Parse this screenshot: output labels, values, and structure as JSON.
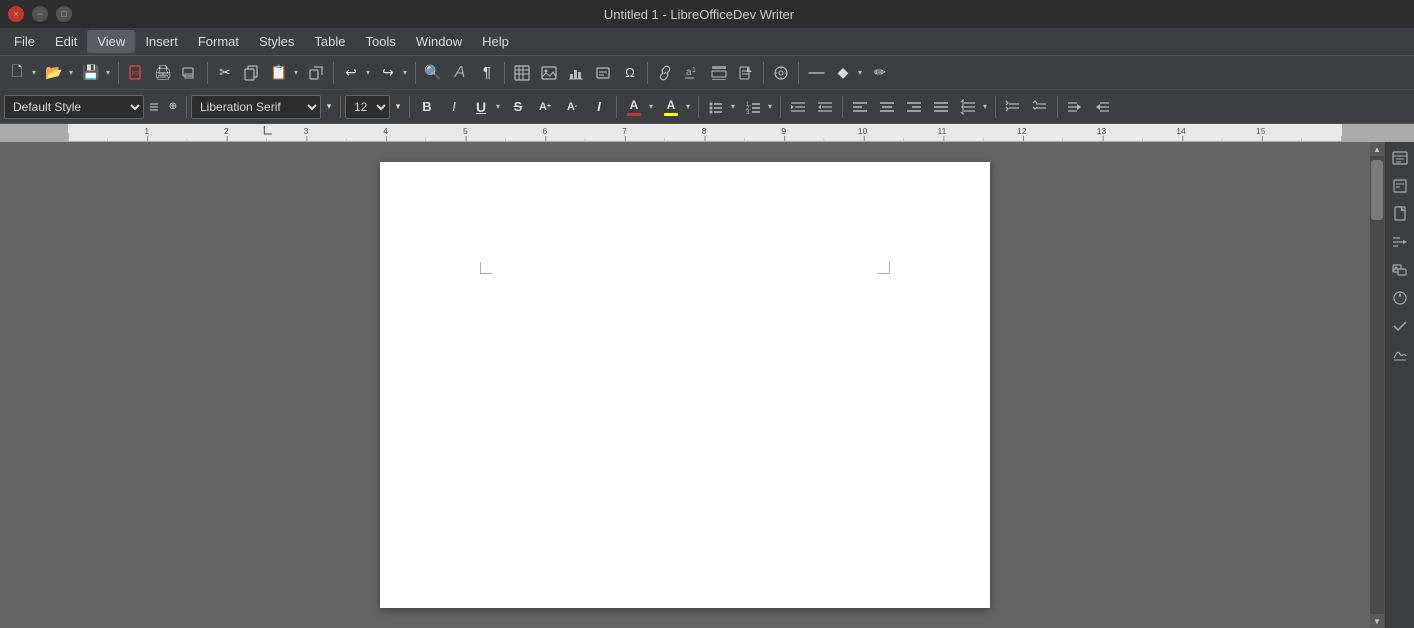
{
  "titlebar": {
    "title": "Untitled 1 - LibreOfficeDev Writer",
    "close_label": "×",
    "minimize_label": "−",
    "maximize_label": "□"
  },
  "menubar": {
    "items": [
      {
        "label": "File"
      },
      {
        "label": "Edit"
      },
      {
        "label": "View"
      },
      {
        "label": "Insert"
      },
      {
        "label": "Format"
      },
      {
        "label": "Styles"
      },
      {
        "label": "Table"
      },
      {
        "label": "Tools"
      },
      {
        "label": "Window"
      },
      {
        "label": "Help"
      }
    ]
  },
  "toolbar1": {
    "new_label": "🗋",
    "open_label": "📂",
    "save_label": "💾",
    "export_pdf_label": "📄",
    "print_label": "🖨",
    "print_preview_label": "🔍",
    "cut_label": "✂",
    "copy_label": "⧉",
    "paste_label": "📋",
    "clone_label": "⊡",
    "undo_label": "↩",
    "redo_label": "↪",
    "find_label": "🔍",
    "styles_label": "A",
    "formatting_marks_label": "¶",
    "table_label": "⊞",
    "image_label": "🖼",
    "chart_label": "📊",
    "text_frame_label": "⬜",
    "special_char_label": "Ω",
    "hyperlink_label": "🔗",
    "footnote_label": "†",
    "header_footer_label": "⬒",
    "page_break_label": "⊡",
    "navigator_label": "◎",
    "line_label": "—",
    "shapes_label": "◆",
    "cursor_label": "✏"
  },
  "toolbar2": {
    "paragraph_style": "Default Style",
    "font_name": "Liberation Serif",
    "font_size": "12",
    "bold_label": "B",
    "italic_label": "I",
    "underline_label": "U",
    "strikethrough_label": "S",
    "superscript_label": "A",
    "subscript_label": "A",
    "shadow_label": "I",
    "font_color_label": "A",
    "font_color_bar": "#c0392b",
    "highlight_label": "A",
    "highlight_color_bar": "#ffff00",
    "list_bullet_label": "≡",
    "list_number_label": "≡",
    "indent_decrease_label": "◁",
    "indent_increase_label": "▷",
    "align_left_label": "≡",
    "align_center_label": "≡",
    "align_right_label": "≡",
    "align_justify_label": "≡",
    "line_spacing_label": "≡",
    "paragraph_label": "¶"
  },
  "document": {
    "page_background": "#ffffff"
  },
  "sidebar": {
    "icons": [
      "☰",
      "⊟",
      "📄",
      "⊿",
      "🖼",
      "◎",
      "✓",
      "⊡"
    ]
  }
}
